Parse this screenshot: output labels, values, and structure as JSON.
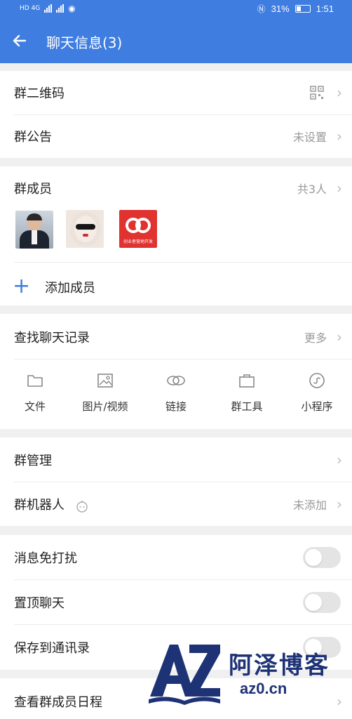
{
  "status_bar": {
    "network_left": "HD 4G",
    "battery": "31%",
    "time": "1:51"
  },
  "header": {
    "back_icon": "arrow-left-icon",
    "title": "聊天信息(3)"
  },
  "group_info": {
    "qr_label": "群二维码",
    "qr_icon": "qr-code-icon",
    "notice_label": "群公告",
    "notice_value": "未设置"
  },
  "members": {
    "label": "群成员",
    "count": "共3人",
    "avatars": [
      "avatar-man-suit",
      "avatar-woman-sunglasses",
      "avatar-red-logo"
    ],
    "avatar3_caption": "创业者营地开发",
    "add_label": "添加成员"
  },
  "history": {
    "label": "查找聊天记录",
    "more": "更多",
    "tools": [
      {
        "label": "文件",
        "icon": "folder-icon"
      },
      {
        "label": "图片/视频",
        "icon": "image-icon"
      },
      {
        "label": "链接",
        "icon": "link-icon"
      },
      {
        "label": "群工具",
        "icon": "briefcase-icon"
      },
      {
        "label": "小程序",
        "icon": "mini-program-icon"
      }
    ]
  },
  "manage": {
    "group_manage": "群管理",
    "robot_label": "群机器人",
    "robot_value": "未添加"
  },
  "settings": {
    "mute": "消息免打扰",
    "pin": "置顶聊天",
    "save_contacts": "保存到通讯录",
    "mute_on": false,
    "pin_on": false,
    "save_on": false
  },
  "schedule": {
    "label": "查看群成员日程"
  },
  "watermark": {
    "logo": "AZ",
    "name": "阿泽博客",
    "url": "az0.cn"
  },
  "colors": {
    "primary": "#3f7de0",
    "watermark": "#1e3276"
  }
}
